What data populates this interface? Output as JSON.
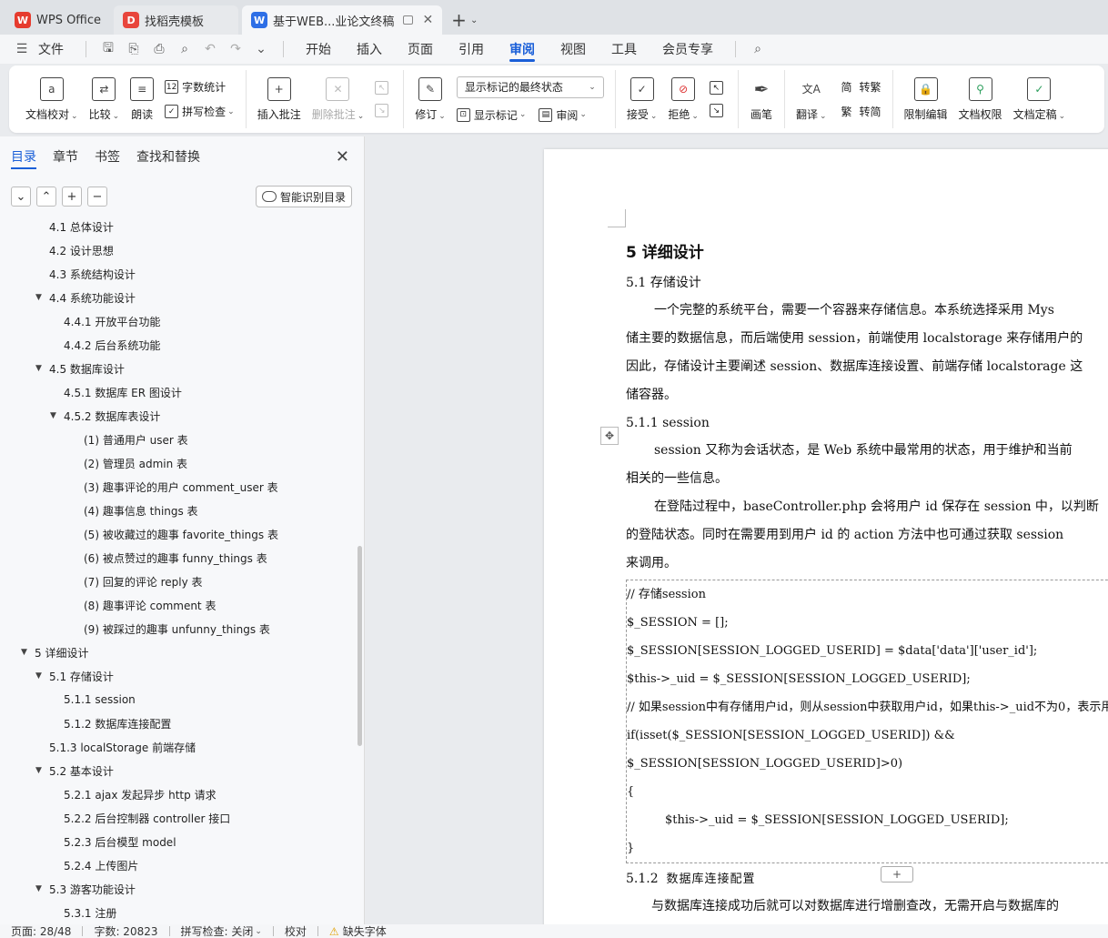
{
  "tabs": [
    {
      "label": "WPS Office",
      "icon": "wps-logo-icon",
      "color": "#e63b2e"
    },
    {
      "label": "找稻壳模板",
      "icon": "docer-logo-icon",
      "color": "#e8453c"
    },
    {
      "label": "基于WEB...业论文终稿",
      "icon": "writer-doc-icon",
      "color": "#2e6fe6",
      "active": true
    }
  ],
  "menubar": {
    "file_label": "文件",
    "items": [
      "开始",
      "插入",
      "页面",
      "引用",
      "审阅",
      "视图",
      "工具",
      "会员专享"
    ],
    "active": "审阅"
  },
  "ribbon": {
    "doc_check": "文档校对",
    "compare": "比较",
    "read_aloud": "朗读",
    "word_count": "字数统计",
    "spell_check": "拼写检查",
    "insert_comment": "插入批注",
    "delete_comment": "删除批注",
    "revise": "修订",
    "markup_state": "显示标记的最终状态",
    "show_markup": "显示标记",
    "review_pane": "审阅",
    "accept": "接受",
    "reject": "拒绝",
    "pen": "画笔",
    "translate": "翻译",
    "to_traditional": "转繁",
    "to_simplified": "转简",
    "restrict_edit": "限制编辑",
    "doc_permission": "文档权限",
    "doc_finalize": "文档定稿"
  },
  "nav": {
    "tabs": [
      "目录",
      "章节",
      "书签",
      "查找和替换"
    ],
    "active_tab": "目录",
    "smart_button": "智能识别目录",
    "toc": [
      {
        "text": "4.1 总体设计",
        "level": 2
      },
      {
        "text": "4.2 设计思想",
        "level": 2
      },
      {
        "text": "4.3 系统结构设计",
        "level": 2
      },
      {
        "text": "4.4 系统功能设计",
        "level": 2,
        "expanded": true
      },
      {
        "text": "4.4.1 开放平台功能",
        "level": 3
      },
      {
        "text": "4.4.2 后台系统功能",
        "level": 3
      },
      {
        "text": "4.5 数据库设计",
        "level": 2,
        "expanded": true
      },
      {
        "text": "4.5.1 数据库 ER 图设计",
        "level": 3
      },
      {
        "text": "4.5.2 数据库表设计",
        "level": 3,
        "expanded": true
      },
      {
        "text": "(1) 普通用户 user 表",
        "level": 4
      },
      {
        "text": "(2) 管理员 admin 表",
        "level": 4
      },
      {
        "text": "(3) 趣事评论的用户 comment_user 表",
        "level": 4
      },
      {
        "text": "(4) 趣事信息 things 表",
        "level": 4
      },
      {
        "text": "(5) 被收藏过的趣事 favorite_things 表",
        "level": 4
      },
      {
        "text": "(6) 被点赞过的趣事 funny_things 表",
        "level": 4
      },
      {
        "text": "(7) 回复的评论 reply 表",
        "level": 4
      },
      {
        "text": "(8) 趣事评论 comment 表",
        "level": 4
      },
      {
        "text": "(9) 被踩过的趣事 unfunny_things 表",
        "level": 4
      },
      {
        "text": "5 详细设计",
        "level": 1,
        "expanded": true
      },
      {
        "text": "5.1 存储设计",
        "level": 2,
        "expanded": true
      },
      {
        "text": "5.1.1 session",
        "level": 3
      },
      {
        "text": "5.1.2 数据库连接配置",
        "level": 3
      },
      {
        "text": "5.1.3 localStorage 前端存储",
        "level": 2
      },
      {
        "text": "5.2 基本设计",
        "level": 2,
        "expanded": true
      },
      {
        "text": "5.2.1 ajax 发起异步 http 请求",
        "level": 3
      },
      {
        "text": "5.2.2 后台控制器 controller 接口",
        "level": 3
      },
      {
        "text": "5.2.3 后台模型 model",
        "level": 3
      },
      {
        "text": "5.2.4 上传图片",
        "level": 3
      },
      {
        "text": "5.3 游客功能设计",
        "level": 2,
        "expanded": true
      },
      {
        "text": "5.3.1 注册",
        "level": 3
      }
    ]
  },
  "document": {
    "h1": "5  详细设计",
    "h2": "5.1 存储设计",
    "p1": [
      "一个完整的系统平台，需要一个容器来存储信息。本系统选择采用 Mys",
      "储主要的数据信息，而后端使用 session，前端使用 localstorage 来存储用户的",
      "因此，存储设计主要阐述 session、数据库连接设置、前端存储 localstorage 这",
      "储容器。"
    ],
    "h3": "5.1.1 session",
    "p2": [
      "session 又称为会话状态，是 Web 系统中最常用的状态，用于维护和当前",
      "相关的一些信息。"
    ],
    "p3": [
      "在登陆过程中，baseController.php 会将用户 id 保存在 session 中，以判断",
      "的登陆状态。同时在需要用到用户 id 的 action 方法中也可通过获取 session",
      "来调用。"
    ],
    "code": [
      "//  存储session",
      "$_SESSION = [];",
      "$_SESSION[SESSION_LOGGED_USERID] = $data['data']['user_id'];",
      "$this->_uid = $_SESSION[SESSION_LOGGED_USERID];",
      "// 如果session中有存储用户id，则从session中获取用户id，如果this->_uid不为0，表示用",
      "if(isset($_SESSION[SESSION_LOGGED_USERID]) &&",
      "$_SESSION[SESSION_LOGGED_USERID]>0)",
      "{",
      "$this->_uid = $_SESSION[SESSION_LOGGED_USERID];",
      "}"
    ],
    "h3b_num": "5.1.2",
    "h3b_text": "数据库连接配置",
    "p4": "与数据库连接成功后就可以对数据库进行增删查改，无需开启与数据库的"
  },
  "statusbar": {
    "page": "页面: 28/48",
    "words": "字数: 20823",
    "spell": "拼写检查: 关闭",
    "proof": "校对",
    "missing_font": "缺失字体"
  },
  "colors": {
    "accent": "#1a5fd8"
  }
}
